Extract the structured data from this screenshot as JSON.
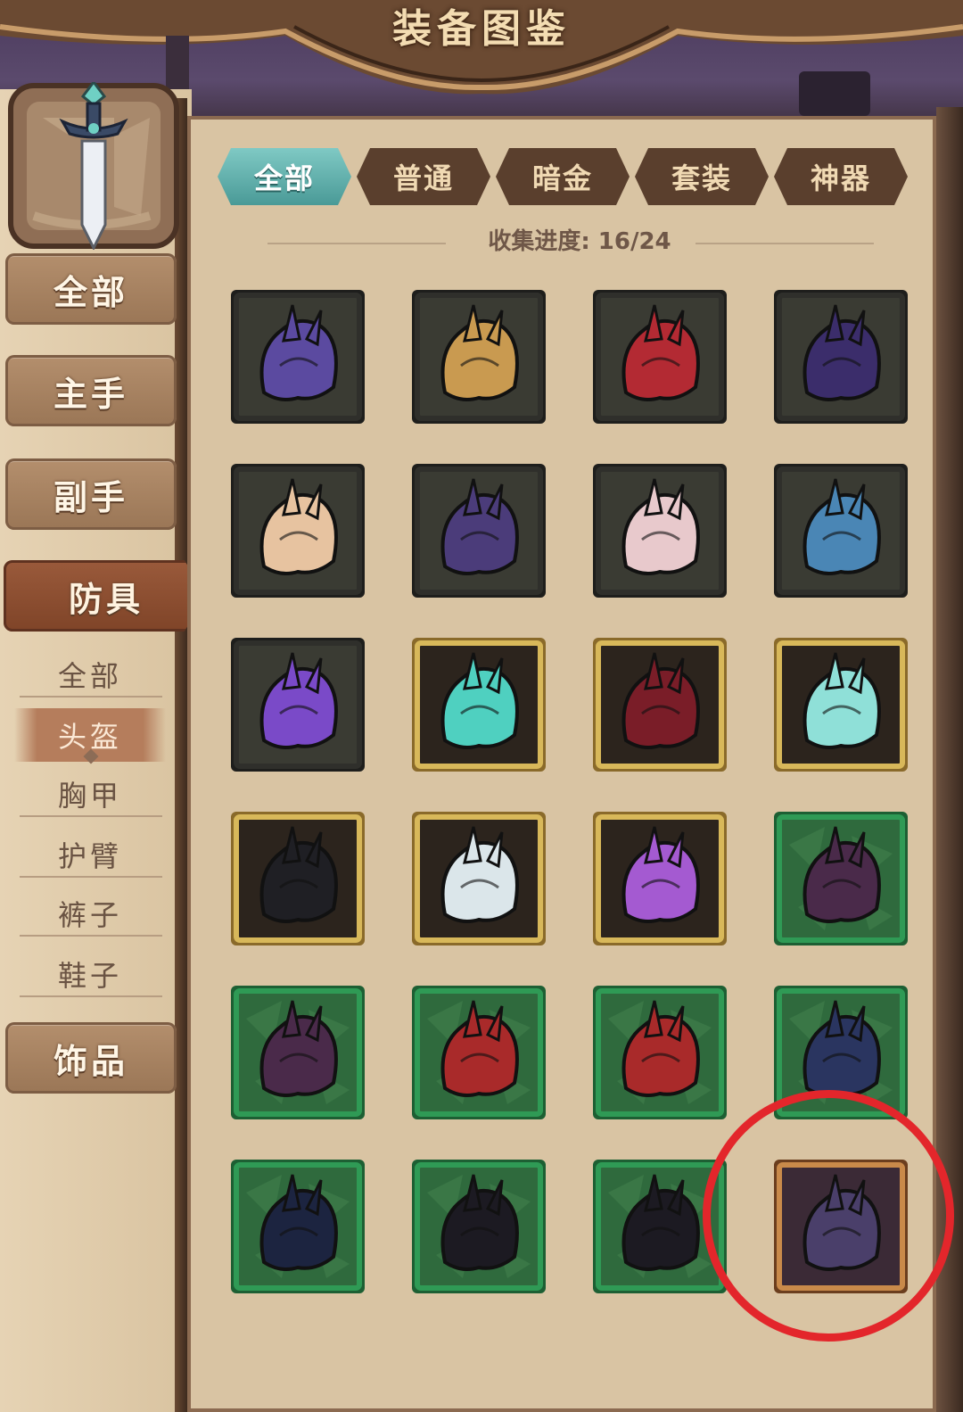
{
  "header": {
    "title": "装备图鉴"
  },
  "sidebar": {
    "categories": [
      {
        "label": "全部"
      },
      {
        "label": "主手"
      },
      {
        "label": "副手"
      },
      {
        "label": "防具"
      },
      {
        "label": "饰品"
      }
    ],
    "active_category": "防具",
    "subcategories": [
      {
        "label": "全部"
      },
      {
        "label": "头盔"
      },
      {
        "label": "胸甲"
      },
      {
        "label": "护臂"
      },
      {
        "label": "裤子"
      },
      {
        "label": "鞋子"
      }
    ],
    "active_subcategory": "头盔"
  },
  "tabs": [
    {
      "label": "全部"
    },
    {
      "label": "普通"
    },
    {
      "label": "暗金"
    },
    {
      "label": "套装"
    },
    {
      "label": "神器"
    }
  ],
  "active_tab": "全部",
  "progress": {
    "label": "收集进度: 16/24"
  },
  "colors": {
    "frame_dark": "#2f2f2b",
    "frame_gold": "#d8b85a",
    "frame_green": "#2f9a55",
    "frame_bronze": "#c98a4a",
    "highlight": "#e3262b",
    "tab_active": "#5fb0ad"
  },
  "items": [
    {
      "name": "rose-headpiece-icon",
      "rarity": "normal"
    },
    {
      "name": "flower-hat-icon",
      "rarity": "normal"
    },
    {
      "name": "red-hood-helmet-icon",
      "rarity": "normal"
    },
    {
      "name": "spiked-circlet-icon",
      "rarity": "normal"
    },
    {
      "name": "shell-horn-helmet-icon",
      "rarity": "normal"
    },
    {
      "name": "feather-headband-icon",
      "rarity": "normal"
    },
    {
      "name": "rose-veil-icon",
      "rarity": "normal"
    },
    {
      "name": "winter-hat-icon",
      "rarity": "normal"
    },
    {
      "name": "lily-flower-icon",
      "rarity": "normal"
    },
    {
      "name": "teal-crest-crown-icon",
      "rarity": "gold"
    },
    {
      "name": "crimson-crown-icon",
      "rarity": "gold"
    },
    {
      "name": "golden-teal-helm-icon",
      "rarity": "gold"
    },
    {
      "name": "horned-hood-icon",
      "rarity": "gold"
    },
    {
      "name": "bone-horn-helm-icon",
      "rarity": "gold"
    },
    {
      "name": "purple-spiked-helm-icon",
      "rarity": "gold"
    },
    {
      "name": "dark-horn-mask-icon",
      "rarity": "set"
    },
    {
      "name": "dark-horn-mask-icon",
      "rarity": "set"
    },
    {
      "name": "red-thorn-crown-icon",
      "rarity": "set"
    },
    {
      "name": "red-thorn-crown-icon",
      "rarity": "set"
    },
    {
      "name": "blue-flame-crown-icon",
      "rarity": "set"
    },
    {
      "name": "blue-flame-mask-icon",
      "rarity": "set"
    },
    {
      "name": "shadow-hood-icon",
      "rarity": "set"
    },
    {
      "name": "shadow-hood-icon",
      "rarity": "set"
    },
    {
      "name": "artifact-dark-crown-icon",
      "rarity": "artifact"
    }
  ]
}
